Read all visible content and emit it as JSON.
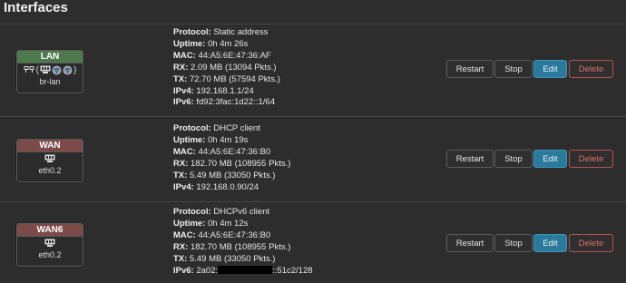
{
  "page": {
    "title": "Interfaces"
  },
  "colors": {
    "lan_header": "#4d7a4d",
    "wan_header": "#7d4a4a",
    "edit_accent": "#2b7a9b",
    "delete_border": "#b85050"
  },
  "interfaces": [
    {
      "name": "LAN",
      "device": "br-lan",
      "icons": [
        "bridge-icon",
        "port-icon",
        "wifi-icon",
        "wifi-icon"
      ],
      "labels": {
        "protocol": "Protocol:",
        "uptime": "Uptime:",
        "mac": "MAC:",
        "rx": "RX:",
        "tx": "TX:",
        "ipv4": "IPv4:",
        "ipv6": "IPv6:"
      },
      "protocol": "Static address",
      "uptime": "0h 4m 26s",
      "mac": "44:A5:6E:47:36:AF",
      "rx": "2.09 MB (13094 Pkts.)",
      "tx": "72.70 MB (57594 Pkts.)",
      "ipv4": "192.168.1.1/24",
      "ipv6": "fd92:3fac:1d22::1/64"
    },
    {
      "name": "WAN",
      "device": "eth0.2",
      "icons": [
        "port-icon"
      ],
      "labels": {
        "protocol": "Protocol:",
        "uptime": "Uptime:",
        "mac": "MAC:",
        "rx": "RX:",
        "tx": "TX:",
        "ipv4": "IPv4:"
      },
      "protocol": "DHCP client",
      "uptime": "0h 4m 19s",
      "mac": "44:A5:6E:47:36:B0",
      "rx": "182.70 MB (108955 Pkts.)",
      "tx": "5.49 MB (33050 Pkts.)",
      "ipv4": "192.168.0.90/24"
    },
    {
      "name": "WAN6",
      "device": "eth0.2",
      "icons": [
        "port-icon"
      ],
      "labels": {
        "protocol": "Protocol:",
        "uptime": "Uptime:",
        "mac": "MAC:",
        "rx": "RX:",
        "tx": "TX:",
        "ipv6": "IPv6:"
      },
      "protocol": "DHCPv6 client",
      "uptime": "0h 4m 12s",
      "mac": "44:A5:6E:47:36:B0",
      "rx": "182.70 MB (108955 Pkts.)",
      "tx": "5.49 MB (33050 Pkts.)",
      "ipv6_prefix": "2a02:",
      "ipv6_suffix": "::51c2/128"
    }
  ],
  "actions": {
    "restart": "Restart",
    "stop": "Stop",
    "edit": "Edit",
    "delete": "Delete"
  }
}
